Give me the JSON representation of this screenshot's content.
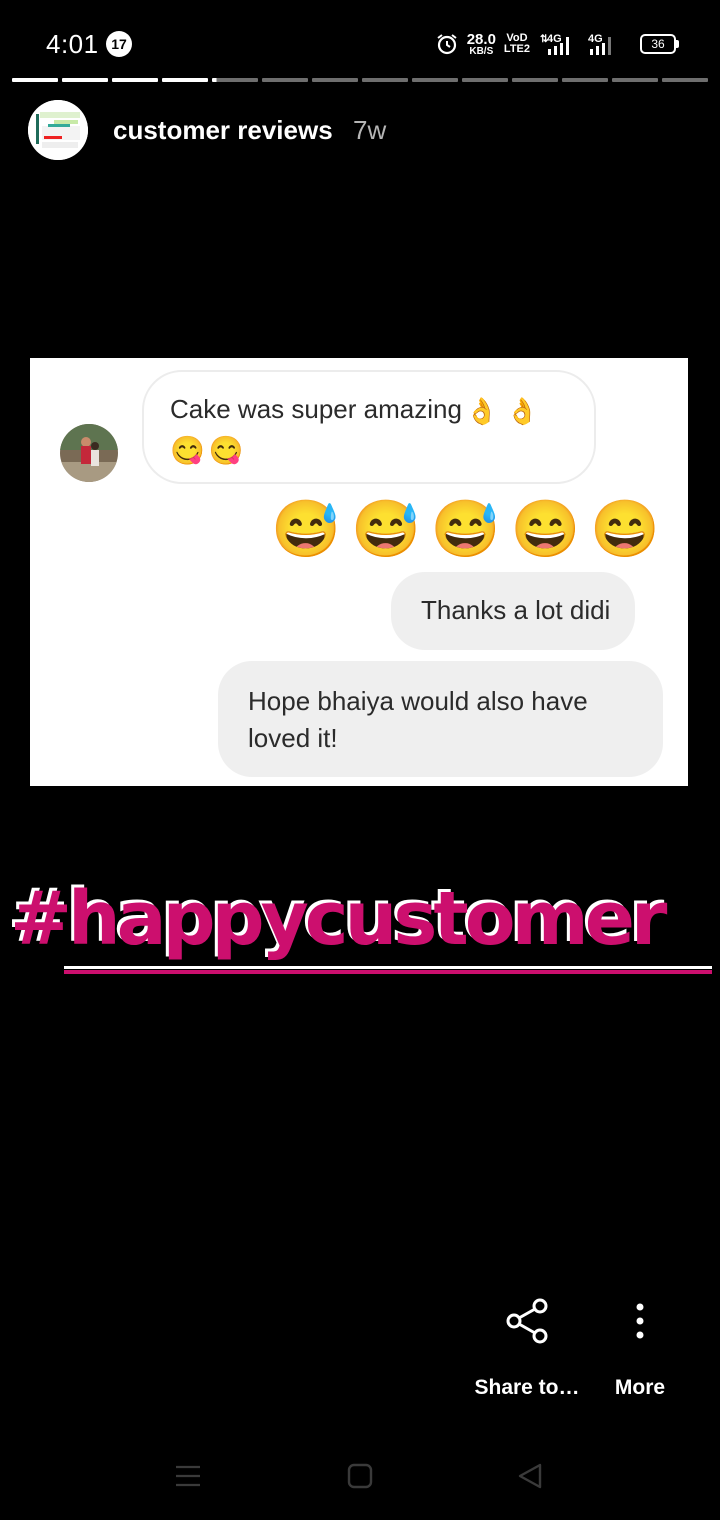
{
  "status_bar": {
    "time": "4:01",
    "notification_count": "17",
    "net_speed_value": "28.0",
    "net_speed_unit": "KB/S",
    "volte_line1": "VoD",
    "volte_line2": "LTE2",
    "signal1_label": "4G",
    "signal2_label": "4G",
    "battery": "36"
  },
  "story": {
    "segments_total": 14,
    "segments_viewed": 4,
    "current_segment_progress": 0.1,
    "account_name": "customer reviews",
    "age": "7w"
  },
  "chat": {
    "incoming_message": "Cake was super amazing",
    "incoming_ok_emoji": [
      "👌",
      "👌"
    ],
    "incoming_yum_emoji": [
      "😋",
      "😋"
    ],
    "reaction_emoji": [
      "😅",
      "😅",
      "😅",
      "😄",
      "😄"
    ],
    "reply_1": "Thanks a lot didi",
    "reply_2": "Hope bhaiya would also have loved it!"
  },
  "hashtag": "#happycustomer",
  "actions": {
    "share_label": "Share to…",
    "more_label": "More"
  },
  "colors": {
    "hashtag": "#cc0f6e",
    "background": "#000000",
    "bubble_out": "#efefef"
  },
  "nav_icons": [
    "menu-icon",
    "home-square-icon",
    "back-triangle-icon"
  ]
}
